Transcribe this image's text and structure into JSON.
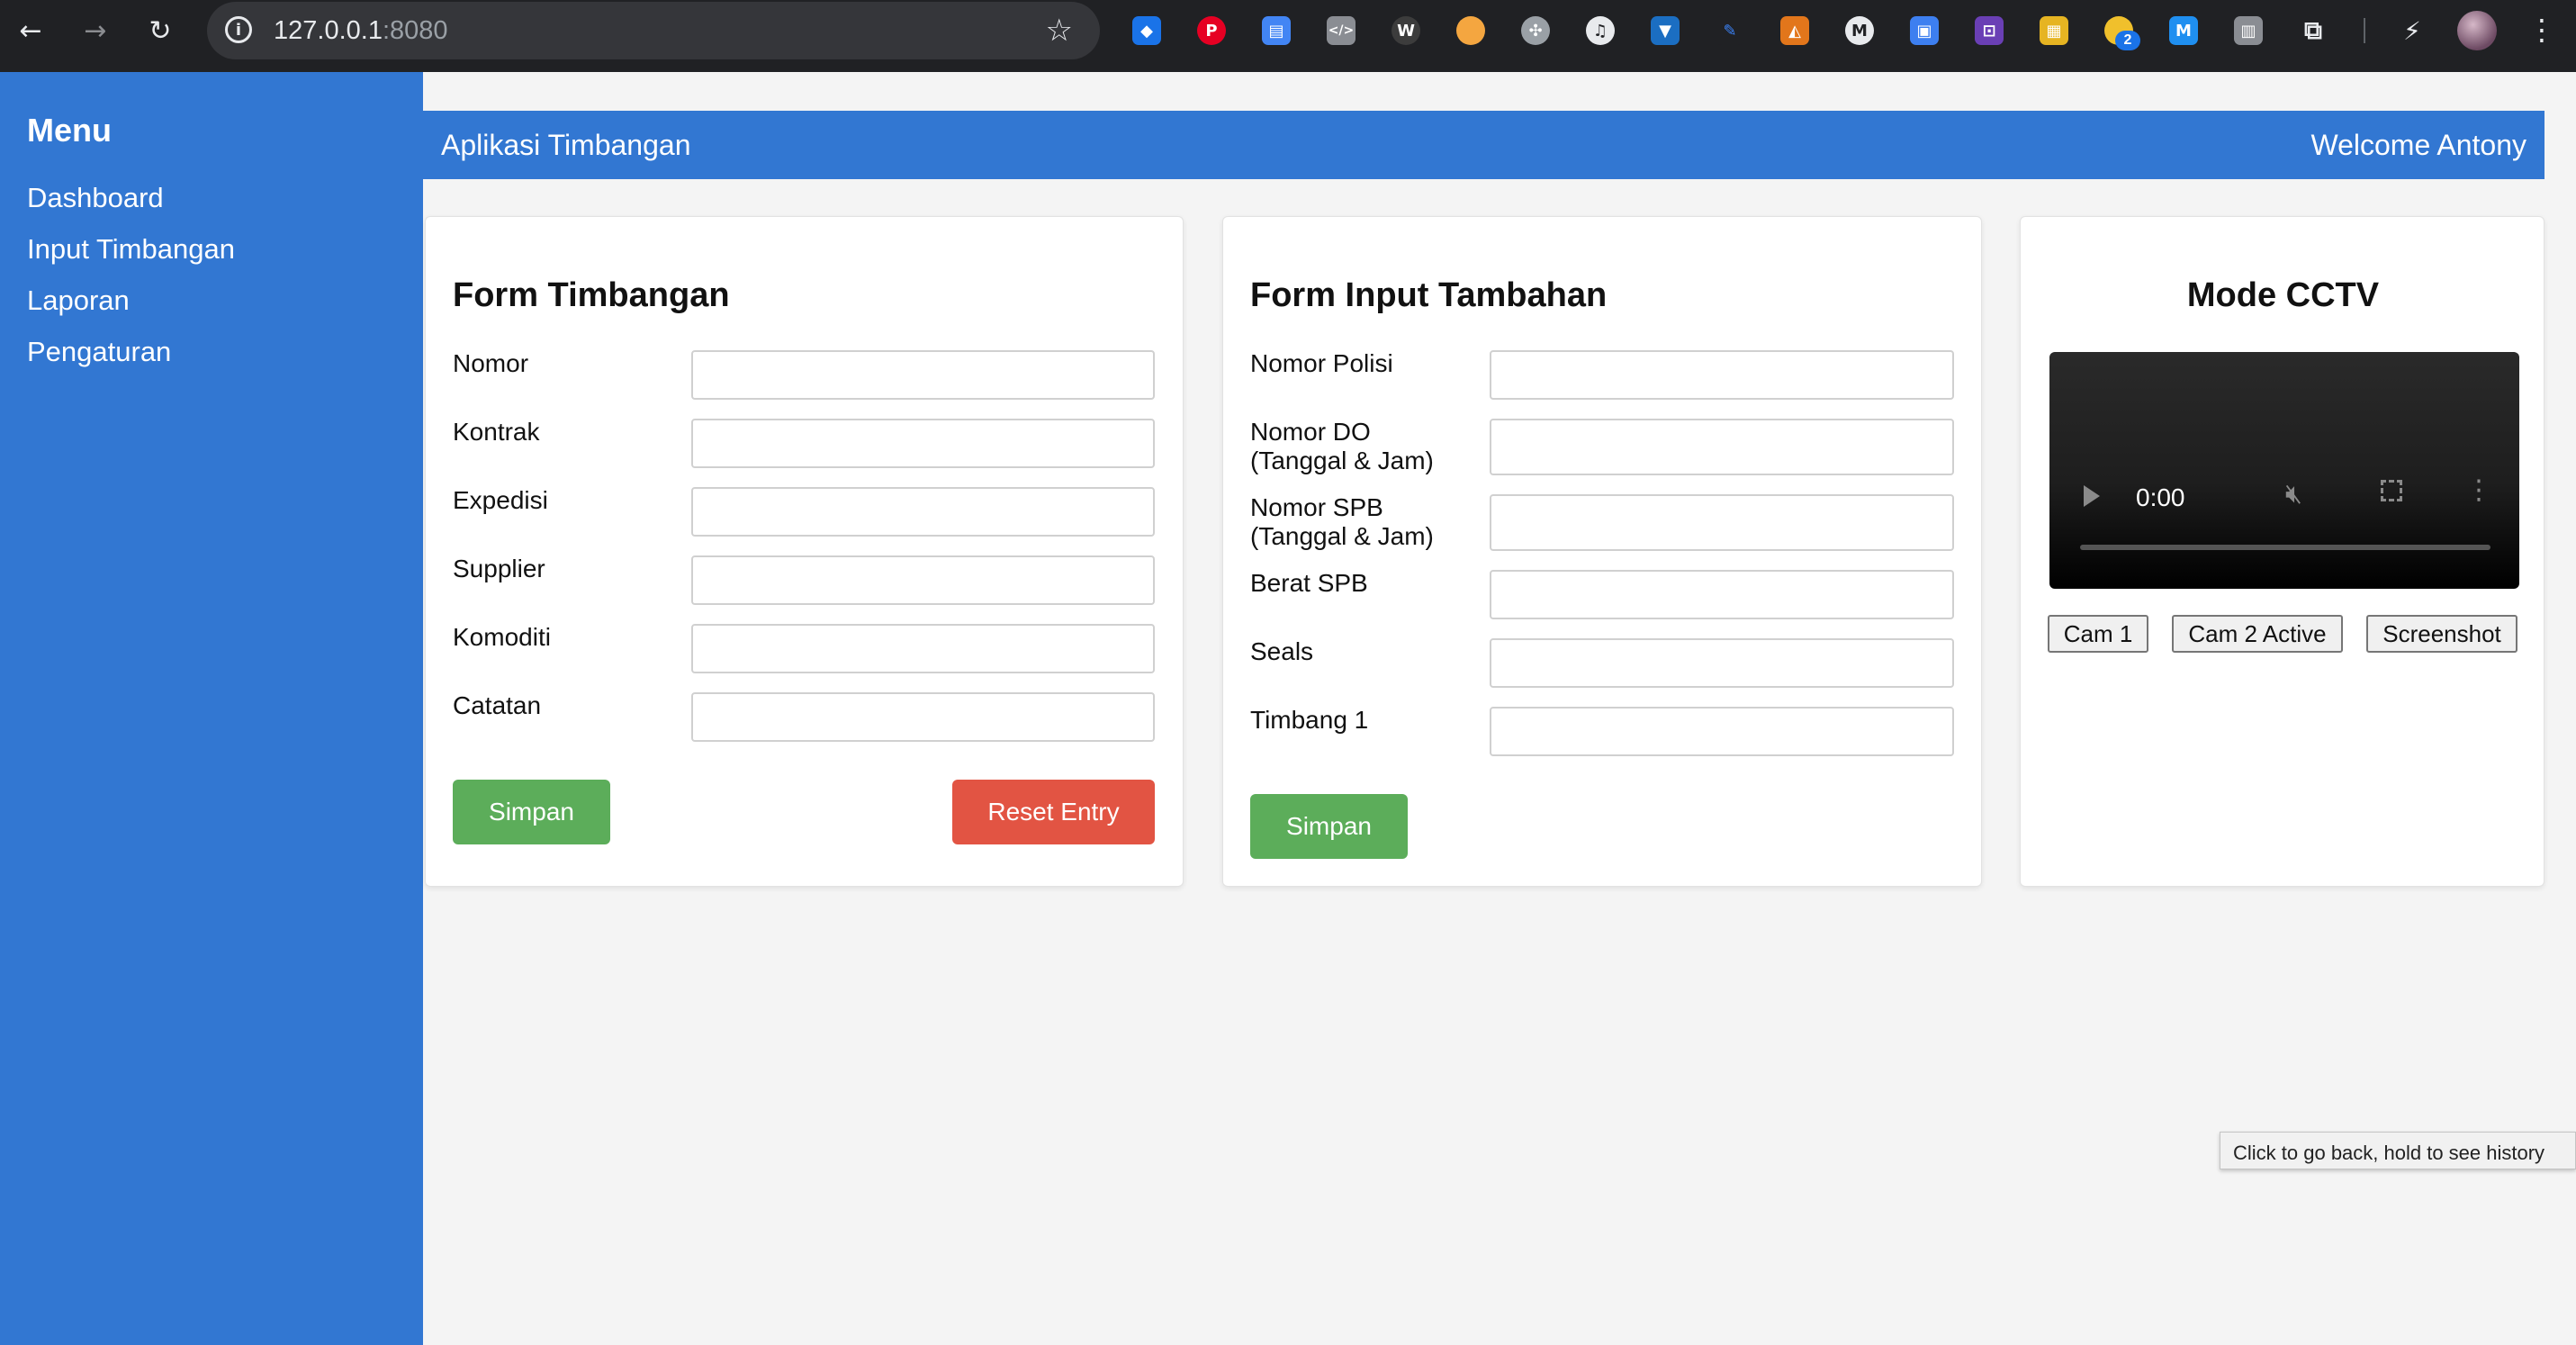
{
  "browser": {
    "url_host": "127.0.0.1",
    "url_port": ":8080",
    "extension_badge": "2",
    "tooltip": "Click to go back, hold to see history"
  },
  "sidebar": {
    "title": "Menu",
    "items": [
      {
        "label": "Dashboard"
      },
      {
        "label": "Input Timbangan"
      },
      {
        "label": "Laporan"
      },
      {
        "label": "Pengaturan"
      }
    ]
  },
  "header": {
    "app_title": "Aplikasi Timbangan",
    "welcome": "Welcome Antony"
  },
  "form_timbangan": {
    "title": "Form Timbangan",
    "fields": [
      {
        "label": "Nomor",
        "value": ""
      },
      {
        "label": "Kontrak",
        "value": ""
      },
      {
        "label": "Expedisi",
        "value": ""
      },
      {
        "label": "Supplier",
        "value": ""
      },
      {
        "label": "Komoditi",
        "value": ""
      },
      {
        "label": "Catatan",
        "value": ""
      }
    ],
    "save_label": "Simpan",
    "reset_label": "Reset Entry"
  },
  "form_tambahan": {
    "title": "Form Input Tambahan",
    "fields": [
      {
        "label": "Nomor Polisi",
        "value": ""
      },
      {
        "label": "Nomor DO",
        "label2": "(Tanggal & Jam)",
        "value": ""
      },
      {
        "label": "Nomor SPB",
        "label2": "(Tanggal & Jam)",
        "value": ""
      },
      {
        "label": "Berat SPB",
        "value": ""
      },
      {
        "label": "Seals",
        "value": ""
      },
      {
        "label": "Timbang 1",
        "value": ""
      }
    ],
    "save_label": "Simpan"
  },
  "cctv": {
    "title": "Mode CCTV",
    "video_time": "0:00",
    "buttons": [
      {
        "label": "Cam 1"
      },
      {
        "label": "Cam 2 Active"
      },
      {
        "label": "Screenshot"
      }
    ]
  },
  "colors": {
    "primary": "#3277d2",
    "save": "#5cad5a",
    "reset": "#e25443",
    "background": "#f4f4f4"
  }
}
